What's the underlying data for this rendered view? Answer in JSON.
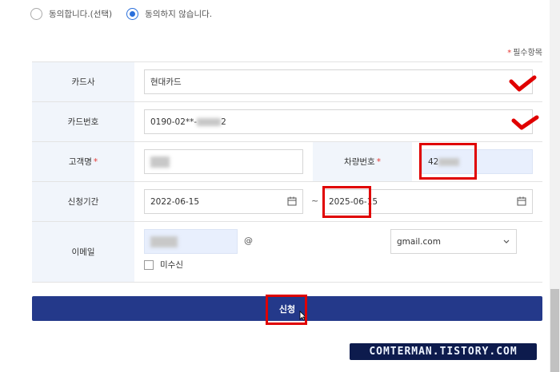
{
  "consent": {
    "agree_label": "동의합니다.(선택)",
    "disagree_label": "동의하지 않습니다.",
    "selected": "disagree"
  },
  "required_note": {
    "star": "*",
    "text": "필수항목"
  },
  "form": {
    "card_company": {
      "label": "카드사",
      "value": "현대카드"
    },
    "card_number": {
      "label": "카드번호",
      "value_prefix": "0190-02**-",
      "value_suffix": "2"
    },
    "customer_name": {
      "label": "고객명",
      "required_mark": "*"
    },
    "vehicle_number": {
      "label": "차량번호",
      "required_mark": "*",
      "value_prefix": "42"
    },
    "period": {
      "label": "신청기간",
      "start": "2022-06-15",
      "separator": "~",
      "end": "2025-06-15"
    },
    "email": {
      "label": "이메일",
      "at": "@",
      "domain": "gmail.com",
      "no_receive_label": "미수신"
    }
  },
  "submit": {
    "label": "신청"
  },
  "watermark": {
    "text": "COMTERMAN.TISTORY.COM"
  },
  "colors": {
    "button": "#24398a",
    "annotation": "#e00000",
    "radio_selected": "#2a6fdb"
  }
}
